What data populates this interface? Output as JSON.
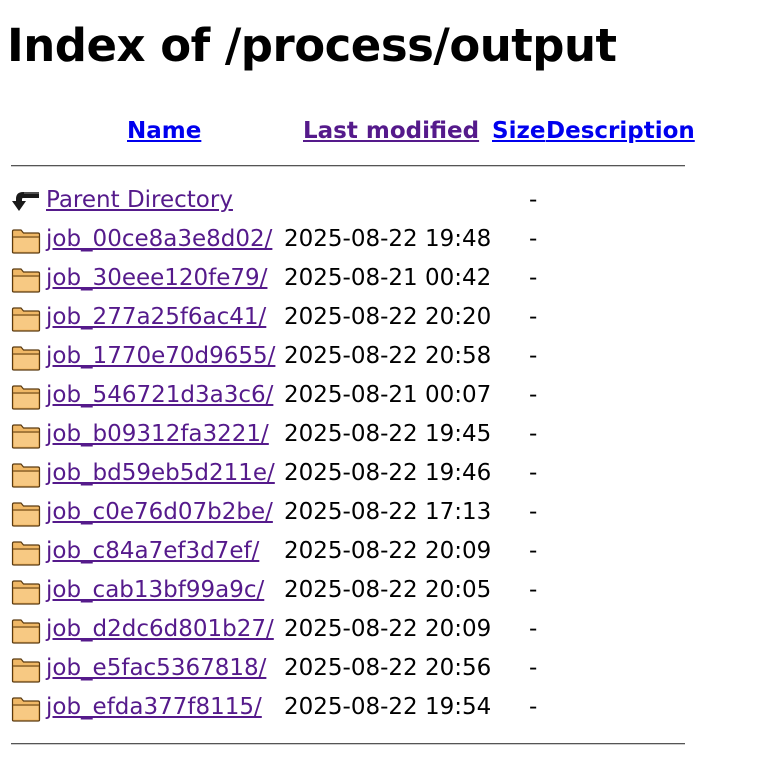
{
  "page": {
    "title": "Index of /process/output"
  },
  "columns": {
    "name": "Name",
    "last_modified": "Last modified",
    "size": "Size",
    "description": "Description"
  },
  "parent": {
    "label": "Parent Directory",
    "size": "-"
  },
  "rows": [
    {
      "name": "job_00ce8a3e8d02/",
      "modified": "2025-08-22 19:48",
      "size": "-"
    },
    {
      "name": "job_30eee120fe79/",
      "modified": "2025-08-21 00:42",
      "size": "-"
    },
    {
      "name": "job_277a25f6ac41/",
      "modified": "2025-08-22 20:20",
      "size": "-"
    },
    {
      "name": "job_1770e70d9655/",
      "modified": "2025-08-22 20:58",
      "size": "-"
    },
    {
      "name": "job_546721d3a3c6/",
      "modified": "2025-08-21 00:07",
      "size": "-"
    },
    {
      "name": "job_b09312fa3221/",
      "modified": "2025-08-22 19:45",
      "size": "-"
    },
    {
      "name": "job_bd59eb5d211e/",
      "modified": "2025-08-22 19:46",
      "size": "-"
    },
    {
      "name": "job_c0e76d07b2be/",
      "modified": "2025-08-22 17:13",
      "size": "-"
    },
    {
      "name": "job_c84a7ef3d7ef/",
      "modified": "2025-08-22 20:09",
      "size": "-"
    },
    {
      "name": "job_cab13bf99a9c/",
      "modified": "2025-08-22 20:05",
      "size": "-"
    },
    {
      "name": "job_d2dc6d801b27/",
      "modified": "2025-08-22 20:09",
      "size": "-"
    },
    {
      "name": "job_e5fac5367818/",
      "modified": "2025-08-22 20:56",
      "size": "-"
    },
    {
      "name": "job_efda377f8115/",
      "modified": "2025-08-22 19:54",
      "size": "-"
    }
  ],
  "icons": {
    "parent": "back-arrow-icon",
    "folder": "folder-icon"
  }
}
